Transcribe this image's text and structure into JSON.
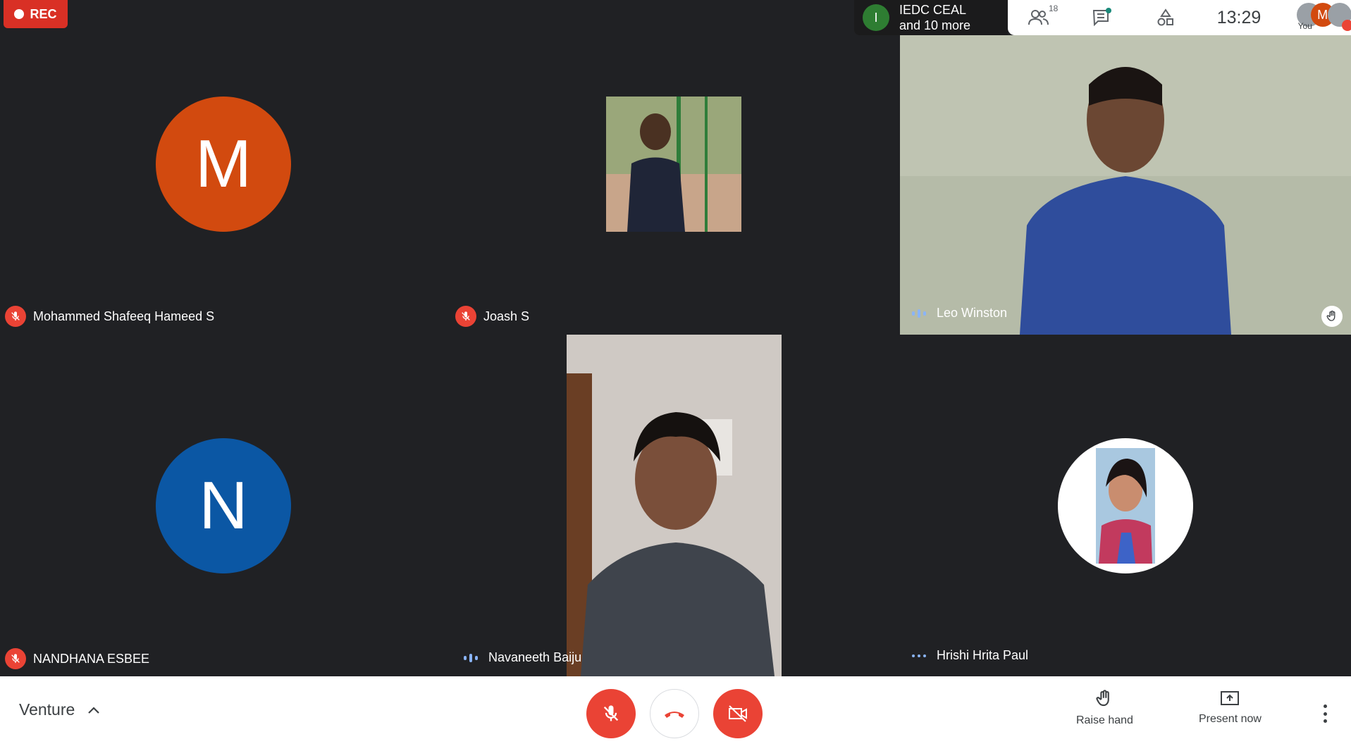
{
  "recording": {
    "label": "REC"
  },
  "presenter_chip": {
    "initial": "I",
    "line1": "IEDC CEAL",
    "line2": "and 10 more"
  },
  "topbar": {
    "participants_count": "18",
    "clock": "13:29",
    "you_label": "You",
    "self_initial": "M"
  },
  "participants": [
    {
      "name": "Mohammed Shafeeq Hameed S",
      "initial": "M",
      "avatar_color": "#d24a0f",
      "muted": true
    },
    {
      "name": "Joash S",
      "muted": true
    },
    {
      "name": "Leo Winston",
      "speaking": true,
      "hand_raised": true
    },
    {
      "name": "NANDHANA ESBEE",
      "initial": "N",
      "avatar_color": "#0b57a4",
      "muted": true
    },
    {
      "name": "Navaneeth Baiju",
      "speaking": true
    },
    {
      "name": "Hrishi Hrita Paul",
      "speaking": true,
      "hand_raised": true
    }
  ],
  "bottom_bar": {
    "meeting_name": "Venture",
    "raise_hand_label": "Raise hand",
    "present_label": "Present now"
  },
  "colors": {
    "danger": "#ea4335",
    "accent": "#8ab4f8",
    "background": "#202124"
  }
}
